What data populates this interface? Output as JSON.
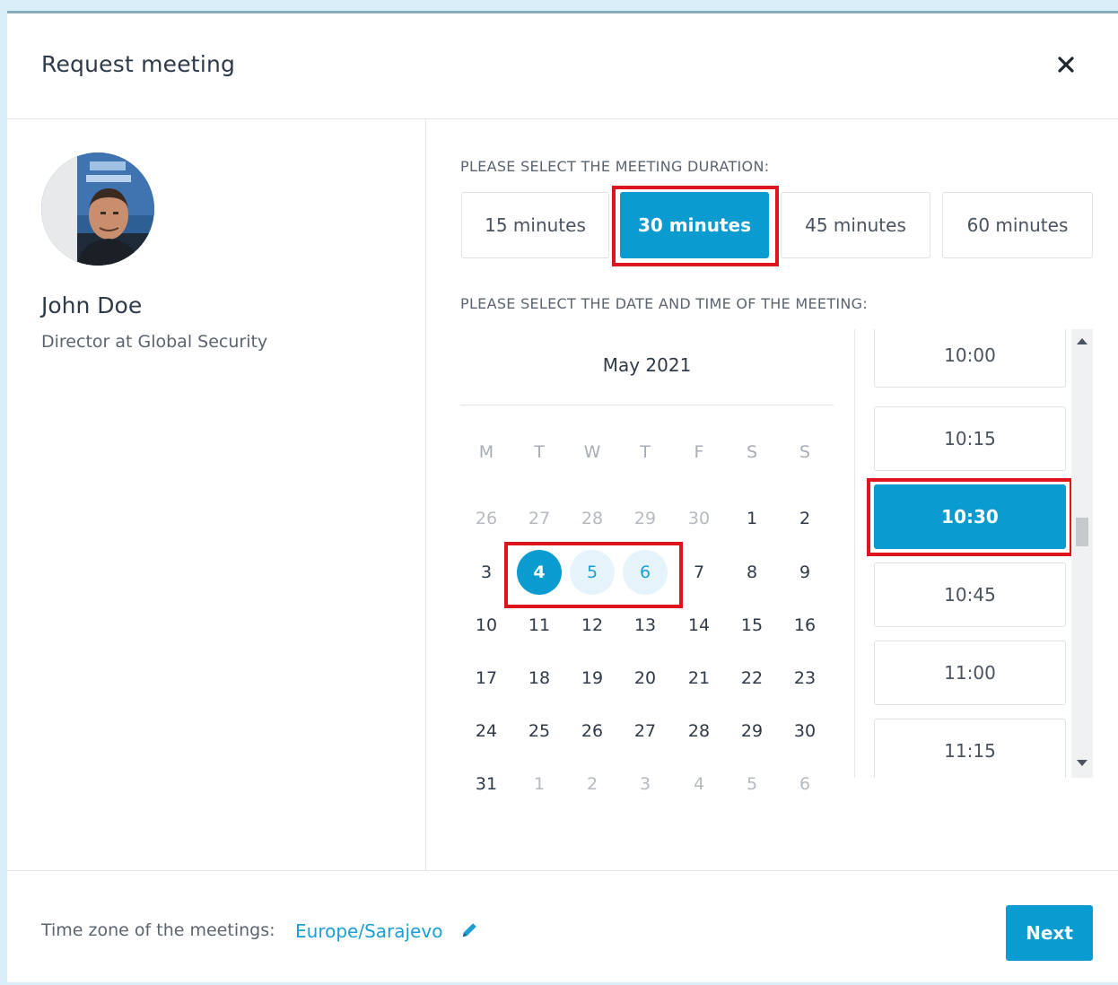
{
  "dialog": {
    "title": "Request meeting",
    "close_icon": "close-icon"
  },
  "person": {
    "name": "John Doe",
    "title": "Director at Global Security"
  },
  "duration": {
    "label": "PLEASE SELECT THE MEETING DURATION:",
    "options": [
      "15 minutes",
      "30 minutes",
      "45 minutes",
      "60 minutes"
    ],
    "selected": "30 minutes"
  },
  "datetime": {
    "label": "PLEASE SELECT THE DATE AND TIME OF THE MEETING:"
  },
  "calendar": {
    "month": "May 2021",
    "weekdays": [
      "M",
      "T",
      "W",
      "T",
      "F",
      "S",
      "S"
    ],
    "weeks": [
      [
        "26",
        "27",
        "28",
        "29",
        "30",
        "1",
        "2"
      ],
      [
        "3",
        "4",
        "5",
        "6",
        "7",
        "8",
        "9"
      ],
      [
        "10",
        "11",
        "12",
        "13",
        "14",
        "15",
        "16"
      ],
      [
        "17",
        "18",
        "19",
        "20",
        "21",
        "22",
        "23"
      ],
      [
        "24",
        "25",
        "26",
        "27",
        "28",
        "29",
        "30"
      ],
      [
        "31",
        "1",
        "2",
        "3",
        "4",
        "5",
        "6"
      ]
    ],
    "selected_day": "4",
    "available_days": [
      "5",
      "6"
    ]
  },
  "time_slots": {
    "slots": [
      "10:00",
      "10:15",
      "10:30",
      "10:45",
      "11:00",
      "11:15"
    ],
    "selected": "10:30"
  },
  "footer": {
    "timezone_label": "Time zone of the meetings:",
    "timezone_value": "Europe/Sarajevo",
    "edit_icon": "pencil-icon",
    "next_label": "Next"
  },
  "colors": {
    "accent": "#0a9bd0",
    "highlight": "#e0141e",
    "background": "#d9eef9"
  }
}
